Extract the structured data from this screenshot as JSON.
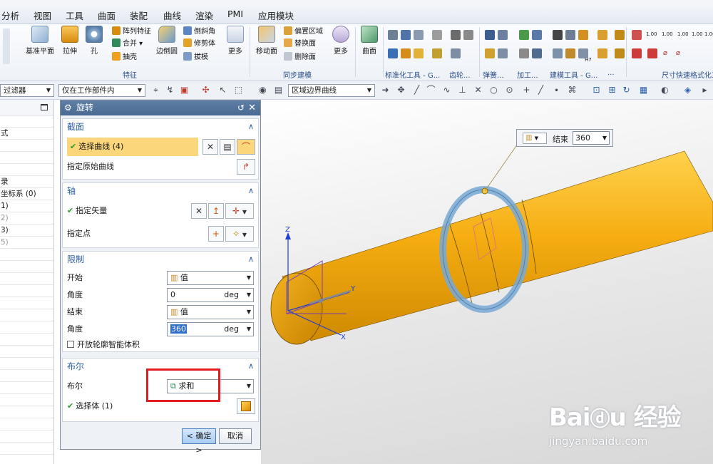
{
  "menu": [
    "分析",
    "视图",
    "工具",
    "曲面",
    "装配",
    "曲线",
    "渲染",
    "PMI",
    "应用模块"
  ],
  "ribbon": {
    "feature": {
      "datum_plane": "基准平面",
      "extrude": "拉伸",
      "hole": "孔",
      "pattern_feature": "阵列特征",
      "unite": "合并",
      "shell": "抽壳",
      "edge_blend": "边倒圆",
      "chamfer": "倒斜角",
      "trim_body": "修剪体",
      "draft": "拔模",
      "more": "更多",
      "group": "特征"
    },
    "sync": {
      "move_face": "移动面",
      "offset_region": "偏置区域",
      "replace_face": "替换面",
      "delete_face": "删除面",
      "more": "更多",
      "group": "同步建模"
    },
    "surface": {
      "label": "曲面"
    },
    "standard_tools": "标准化工具 - G...",
    "gear": "齿轮...",
    "spring": "弹簧...",
    "machining": "加工...",
    "modeling_tools": "建模工具 - G...",
    "more_small": "...",
    "dim_format": "尺寸快速格式化工",
    "dim_numbers": [
      "1.00",
      "1.00",
      "1.00",
      "1.00",
      "1.00"
    ],
    "tol": "H7"
  },
  "toolbar2": {
    "filter_value": "过滤器",
    "scope_value": "仅在工作部件内",
    "curve_rule_value": "区域边界曲线"
  },
  "navigator": {
    "rows": [
      {
        "text": "",
        "dim": false
      },
      {
        "text": "式",
        "dim": false
      },
      {
        "text": "",
        "dim": false
      },
      {
        "text": "",
        "dim": false
      },
      {
        "text": "",
        "dim": false
      },
      {
        "text": "录",
        "dim": false
      },
      {
        "text": "坐标系 (0)",
        "dim": false
      },
      {
        "text": "1)",
        "dim": false
      },
      {
        "text": "2)",
        "dim": true
      },
      {
        "text": "3)",
        "dim": false
      },
      {
        "text": "5)",
        "dim": true
      }
    ]
  },
  "dialog": {
    "title": "旋转",
    "section": {
      "header": "截面",
      "select_curve": "选择曲线 (4)",
      "specify_origin_curve": "指定原始曲线"
    },
    "axis": {
      "header": "轴",
      "specify_vector": "指定矢量",
      "specify_point": "指定点"
    },
    "limits": {
      "header": "限制",
      "start_label": "开始",
      "start_value": "值",
      "angle_label": "角度",
      "start_angle": "0",
      "end_label": "结束",
      "end_value": "值",
      "end_angle_label": "角度",
      "end_angle": "360",
      "unit": "deg",
      "open_profile": "开放轮廓智能体积"
    },
    "boolean": {
      "header": "布尔",
      "label": "布尔",
      "value": "求和",
      "select_body": "选择体 (1)"
    },
    "ok": "< 确定 >",
    "cancel": "取消"
  },
  "viewport": {
    "popup": {
      "label": "结束",
      "value": "360"
    },
    "axis_labels": {
      "z": "Z",
      "y": "Y",
      "x": "X"
    }
  },
  "watermark": {
    "site": "jingyan.baidu.com"
  },
  "colors": {
    "body_orange": "#f6ad12",
    "ring_blue": "#78a8d4",
    "highlight_row": "#fcd67b",
    "section_header": "#2b5ea8",
    "annotation_red": "#e01b24"
  }
}
